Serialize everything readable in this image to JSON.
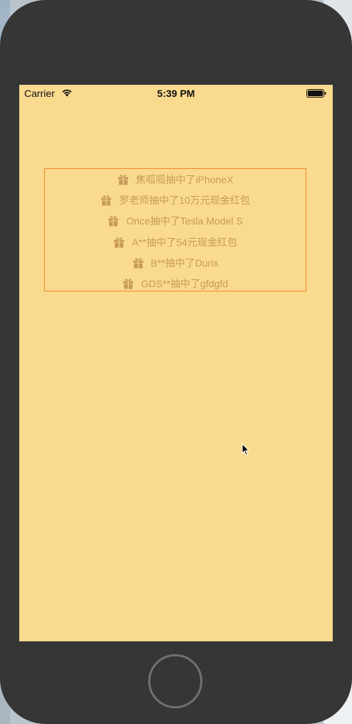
{
  "status_bar": {
    "carrier": "Carrier",
    "time": "5:39 PM",
    "wifi_icon": "wifi-icon",
    "battery_icon": "battery-icon"
  },
  "prize_marquee": {
    "border_color": "#f08a2c",
    "text_color": "#c89a58",
    "icon": "gift-icon",
    "items": [
      "焦呱呱抽中了iPhoneX",
      "罗老师抽中了10万元现金红包",
      "Once抽中了Tesla Model S",
      "A**抽中了54元现金红包",
      "B**抽中了Durix",
      "GDS**抽中了gfdgfd"
    ]
  },
  "screen": {
    "background_color": "#f9da8e"
  },
  "device": {
    "frame_color": "#363636"
  }
}
